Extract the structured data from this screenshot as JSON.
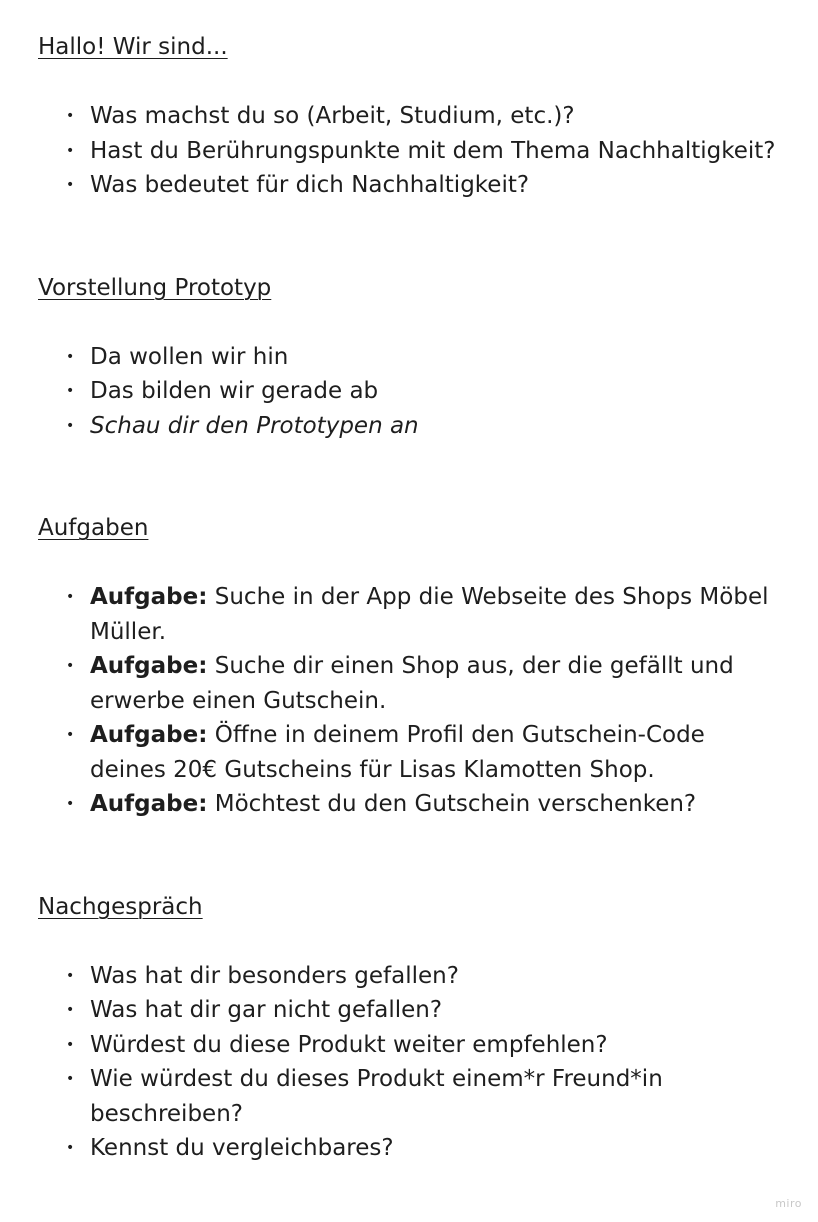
{
  "sections": [
    {
      "heading": "Hallo! Wir sind...",
      "items": [
        {
          "text": "Was machst du so (Arbeit, Studium, etc.)?"
        },
        {
          "text": "Hast du Berührungspunkte mit dem Thema Nachhaltigkeit?"
        },
        {
          "text": "Was bedeutet für dich Nachhaltigkeit?"
        }
      ]
    },
    {
      "heading": "Vorstellung Prototyp",
      "items": [
        {
          "text": "Da wollen wir hin"
        },
        {
          "text": "Das bilden wir gerade ab"
        },
        {
          "text": "Schau dir den Prototypen an",
          "italic": true
        }
      ]
    },
    {
      "heading": "Aufgaben",
      "items": [
        {
          "lead": "Aufgabe:",
          "text": " Suche in der App die Webseite des Shops Möbel Müller."
        },
        {
          "lead": "Aufgabe:",
          "text": " Suche dir einen Shop aus, der die gefällt und erwerbe einen Gutschein."
        },
        {
          "lead": "Aufgabe:",
          "text": " Öffne in deinem Profil den Gutschein-Code deines 20€ Gutscheins für Lisas Klamotten Shop."
        },
        {
          "lead": "Aufgabe:",
          "text": " Möchtest du den Gutschein verschenken?"
        }
      ]
    },
    {
      "heading": "Nachgespräch",
      "items": [
        {
          "text": "Was hat dir besonders gefallen?"
        },
        {
          "text": "Was hat dir gar nicht gefallen?"
        },
        {
          "text": "Würdest du diese Produkt weiter empfehlen?"
        },
        {
          "text": "Wie würdest du dieses Produkt einem*r Freund*in beschreiben?"
        },
        {
          "text": "Kennst du vergleichbares?"
        }
      ]
    }
  ],
  "bullet_char": "•",
  "watermark": "miro"
}
